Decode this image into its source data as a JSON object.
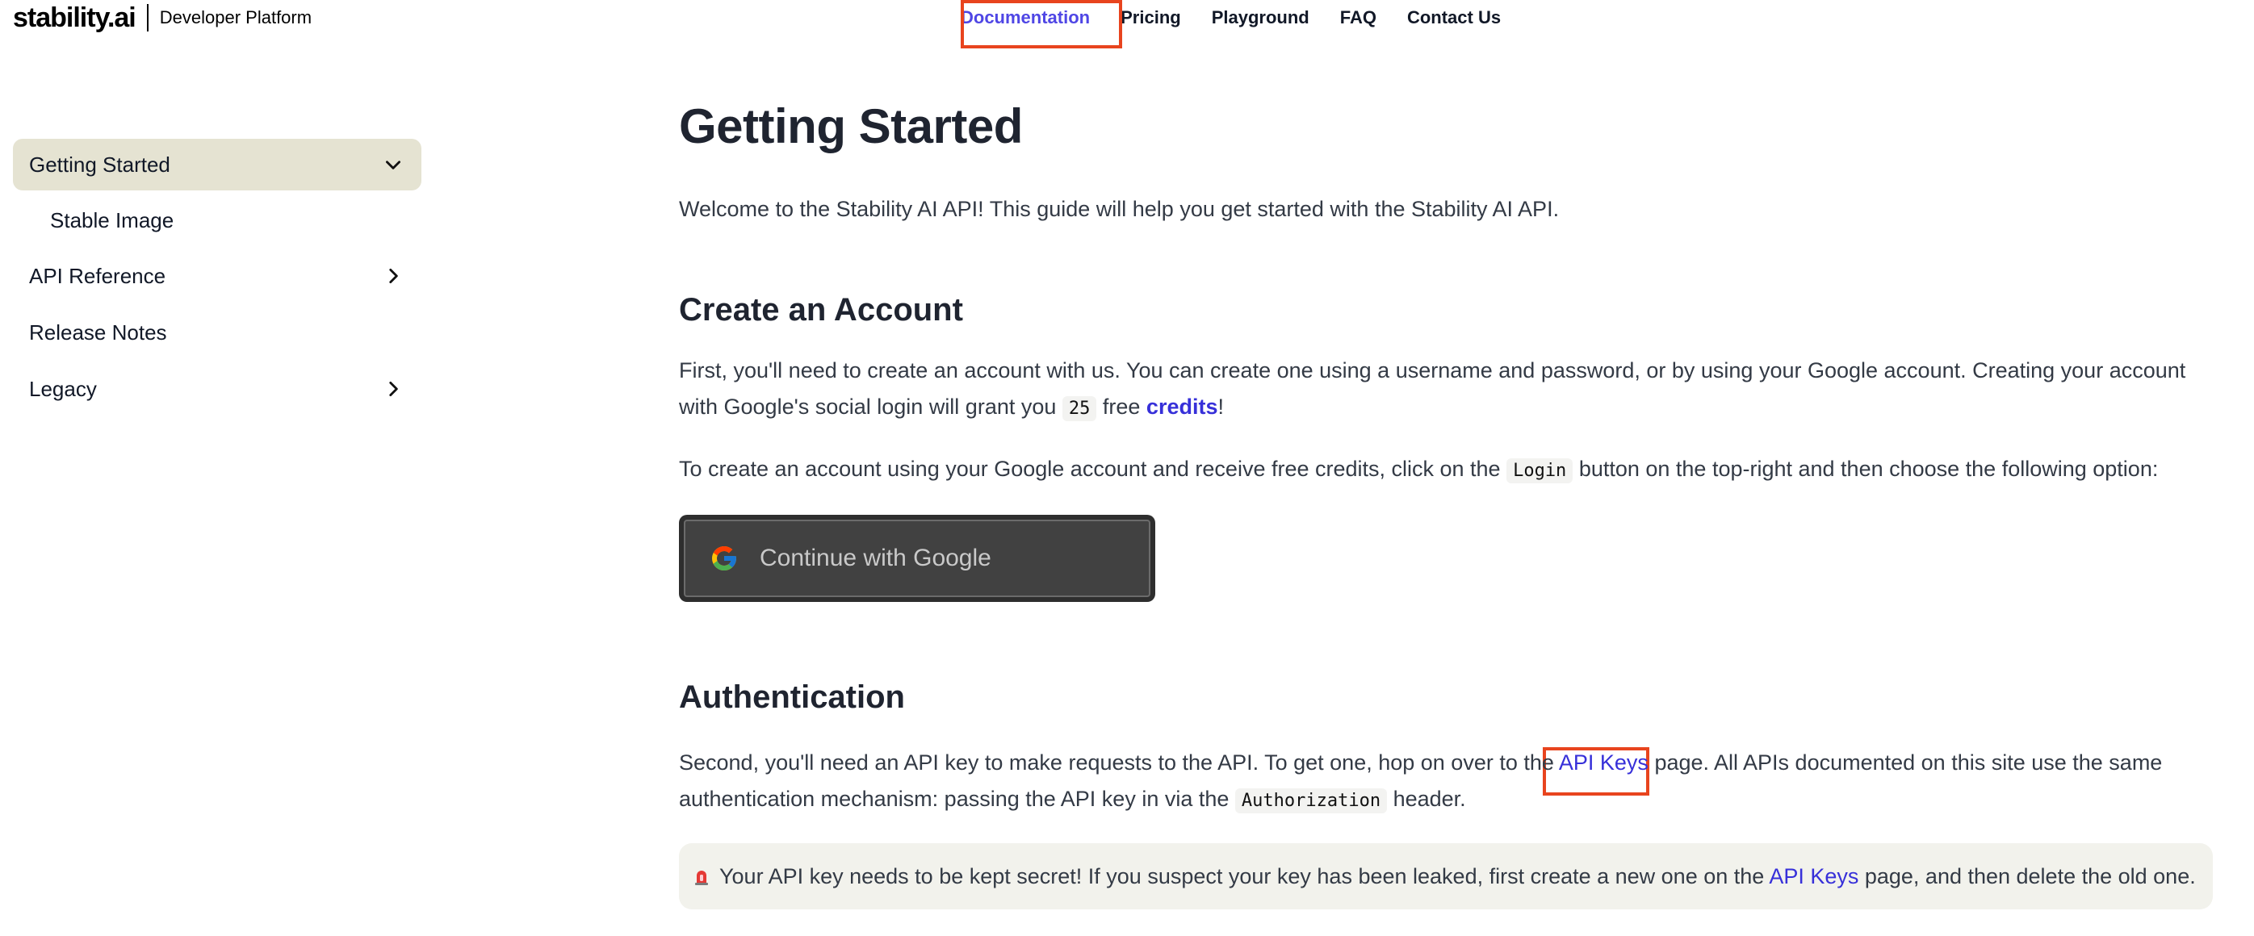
{
  "header": {
    "logo_text": "stability.ai",
    "platform_label": "Developer Platform",
    "nav": [
      {
        "label": "Documentation",
        "active": true
      },
      {
        "label": "Pricing"
      },
      {
        "label": "Playground"
      },
      {
        "label": "FAQ"
      },
      {
        "label": "Contact Us"
      }
    ]
  },
  "sidebar": {
    "items": [
      {
        "label": "Getting Started",
        "icon": "chevron-down-icon",
        "active": true
      },
      {
        "label": "Stable Image"
      },
      {
        "label": "API Reference",
        "icon": "chevron-right-icon"
      },
      {
        "label": "Release Notes"
      },
      {
        "label": "Legacy",
        "icon": "chevron-right-icon"
      }
    ]
  },
  "main": {
    "title": "Getting Started",
    "intro": "Welcome to the Stability AI API! This guide will help you get started with the Stability AI API.",
    "create_account": {
      "heading": "Create an Account",
      "p1_a": "First, you'll need to create an account with us. You can create one using a username and password, or by using your Google account. Creating your account with Google's social login will grant you ",
      "credits_amount": "25",
      "p1_b": " free ",
      "credits_link": "credits",
      "p1_c": "!",
      "p2_a": "To create an account using your Google account and receive free credits, click on the ",
      "login_code": "Login",
      "p2_b": " button on the top-right and then choose the following option:",
      "google_button": "Continue with Google"
    },
    "authentication": {
      "heading": "Authentication",
      "p1_a": "Second, you'll need an API key to make requests to the API. To get one, hop on over to the ",
      "api_keys_link": "API Keys",
      "p1_b": " page. All APIs documented on this site use the same authentication mechanism: passing the API key in via the ",
      "auth_code": "Authorization",
      "p1_c": " header.",
      "callout_a": "Your API key needs to be kept secret! If you suspect your key has been leaked, first create a new one on the ",
      "callout_link": "API Keys",
      "callout_b": " page, and then delete the old one."
    }
  },
  "colors": {
    "accent": "#4f46e5",
    "link": "#3730d9",
    "highlight": "#e8441e",
    "sidebar_active": "#e5e3d2"
  }
}
